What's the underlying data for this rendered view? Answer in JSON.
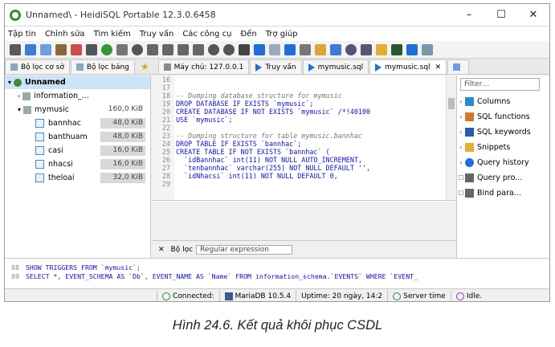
{
  "window": {
    "title": "Unnamed\\ - HeidiSQL Portable 12.3.0.6458",
    "min": "–",
    "max": "☐",
    "close": "✕"
  },
  "menu": [
    "Tập tin",
    "Chỉnh sửa",
    "Tìm kiếm",
    "Truy vấn",
    "Các công cụ",
    "Đến",
    "Trợ giúp"
  ],
  "toolbar_icons": [
    "plug-icon",
    "save-icon",
    "copy-icon",
    "paste-icon",
    "undo-icon",
    "redo-icon",
    "refresh-icon",
    "disconnect-icon",
    "stop-icon",
    "first-icon",
    "prev-icon",
    "next-icon",
    "last-icon",
    "add-icon",
    "remove-icon",
    "cancel-icon",
    "run-icon",
    "run-dropdown-icon",
    "play-icon",
    "list-icon",
    "open-icon",
    "save-file-icon",
    "search-icon",
    "zoom-icon",
    "pencil-icon",
    "sql-icon",
    "help-icon",
    "layout-icon"
  ],
  "left_tabs": [
    "Bộ lọc cơ sở",
    "Bộ lọc bảng"
  ],
  "main_tabs": [
    {
      "label": "Máy chủ: 127.0.0.1"
    },
    {
      "label": "Truy vấn"
    },
    {
      "label": "mymusic.sql"
    },
    {
      "label": "mymusic.sql"
    }
  ],
  "tree": {
    "root": "Unnamed",
    "info": "information_...",
    "db": {
      "name": "mymusic",
      "size": "160,0 KiB"
    },
    "tables": [
      {
        "name": "bannhac",
        "size": "48,0 KiB"
      },
      {
        "name": "banthuam",
        "size": "48,0 KiB"
      },
      {
        "name": "casi",
        "size": "16,0 KiB"
      },
      {
        "name": "nhacsi",
        "size": "16,0 KiB"
      },
      {
        "name": "theloai",
        "size": "32,0 KiB"
      }
    ]
  },
  "editor": {
    "line_numbers": [
      "16",
      "17",
      "18",
      "19",
      "20",
      "21",
      "22",
      "23",
      "24",
      "25",
      "26",
      "27",
      "28",
      "29"
    ],
    "lines": [
      "",
      "",
      "-- Dumping database structure for mymusic",
      "DROP DATABASE IF EXISTS `mymusic`;",
      "CREATE DATABASE IF NOT EXISTS `mymusic` /*!40100",
      "USE `mymusic`;",
      "",
      "-- Dumping structure for table mymusic.bannhac",
      "DROP TABLE IF EXISTS `bannhac`;",
      "CREATE TABLE IF NOT EXISTS `bannhac` (",
      "  `idBannhac` int(11) NOT NULL AUTO_INCREMENT,",
      "  `tenbannhac` varchar(255) NOT NULL DEFAULT '',",
      "  `idNhacsi` int(11) NOT NULL DEFAULT 0,",
      ""
    ]
  },
  "filter_bar": {
    "close": "✕",
    "label": "Bộ lọc",
    "value": "Regular expression"
  },
  "helpers": {
    "filter_placeholder": "Filter",
    "items": [
      {
        "label": "Columns",
        "icon": "columns-icon"
      },
      {
        "label": "SQL functions",
        "icon": "function-icon"
      },
      {
        "label": "SQL keywords",
        "icon": "keyword-icon"
      },
      {
        "label": "Snippets",
        "icon": "snippet-icon"
      },
      {
        "label": "Query history",
        "icon": "history-icon"
      },
      {
        "label": "Query pro...",
        "icon": "profile-icon"
      },
      {
        "label": "Bind para...",
        "icon": "bind-icon"
      }
    ]
  },
  "log": {
    "line_numbers": [
      "88",
      "89"
    ],
    "lines": [
      "SHOW TRIGGERS FROM `mymusic`;",
      "SELECT *, EVENT_SCHEMA AS `Db`, EVENT_NAME AS `Name` FROM information_schema.`EVENTS` WHERE `EVENT_"
    ]
  },
  "status": {
    "connected": "Connected:",
    "server": "MariaDB 10.5.4",
    "uptime": "Uptime: 20 ngày, 14:2",
    "server_time": "Server time",
    "idle": "Idle."
  },
  "caption": "Hình 24.6. Kết quả khôi phục CSDL"
}
